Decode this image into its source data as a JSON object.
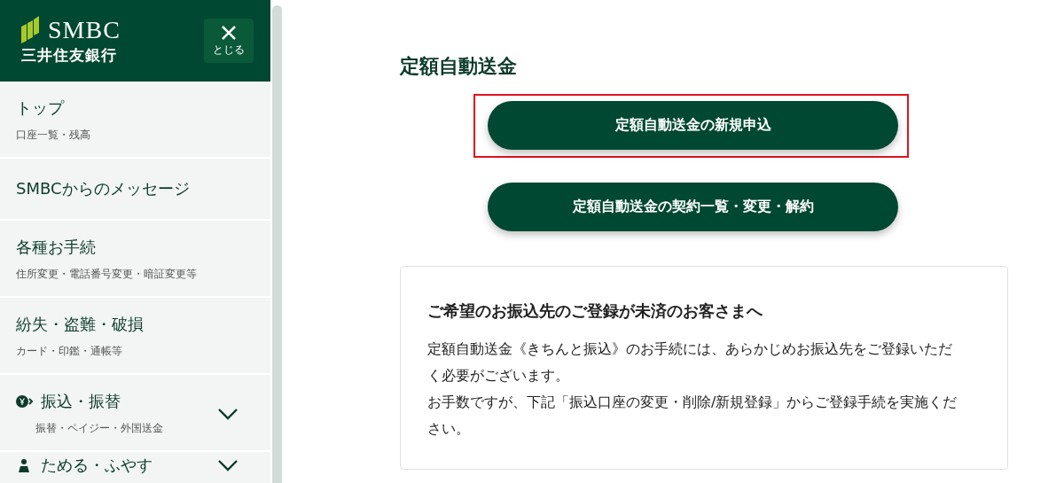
{
  "sidebar": {
    "logo": {
      "name": "SMBC",
      "bank": "三井住友銀行"
    },
    "close_button": {
      "label": "とじる"
    },
    "items": [
      {
        "label": "トップ",
        "sub": "口座一覧・残高",
        "kind": "link"
      },
      {
        "label": "SMBCからのメッセージ",
        "kind": "link"
      },
      {
        "label": "各種お手続",
        "sub": "住所変更・電話番号変更・暗証変更等",
        "kind": "link"
      },
      {
        "label": "紛失・盗難・破損",
        "sub": "カード・印鑑・通帳等",
        "kind": "link"
      },
      {
        "label": "振込・振替",
        "sub": "振替・ペイジー・外国送金",
        "kind": "money",
        "expanded": false
      },
      {
        "label": "ためる・ふやす",
        "kind": "savings",
        "expanded": false
      }
    ]
  },
  "main": {
    "title": "定額自動送金",
    "buttons": [
      {
        "label": "定額自動送金の新規申込",
        "highlighted": true
      },
      {
        "label": "定額自動送金の契約一覧・変更・解約",
        "highlighted": false
      }
    ],
    "notice": {
      "heading": "ご希望のお振込先のご登録が未済のお客さまへ",
      "paragraphs": [
        "定額自動送金《きちんと振込》のお手続には、あらかじめお振込先をご登録いただく必要がございます。",
        "お手数ですが、下記「振込口座の変更・削除/新規登録」からご登録手続を実施ください。"
      ]
    }
  }
}
